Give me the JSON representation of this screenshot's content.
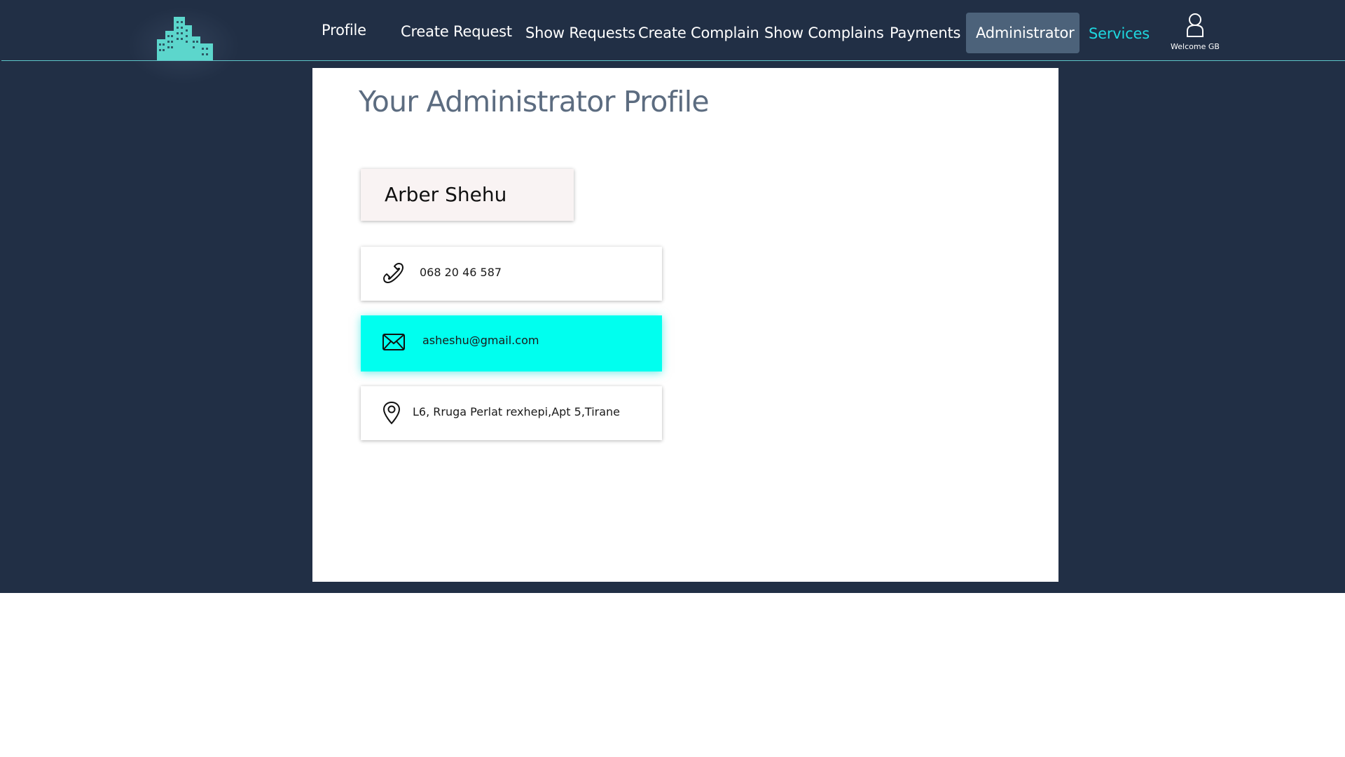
{
  "nav": {
    "items": [
      {
        "label": "Profile"
      },
      {
        "label": "Create Request"
      },
      {
        "label": "Show Requests"
      },
      {
        "label": "Create Complain"
      },
      {
        "label": "Show Complains"
      },
      {
        "label": "Payments"
      },
      {
        "label": "Administrator",
        "active": true
      },
      {
        "label": "Services"
      }
    ],
    "user_label": "Welcome GB",
    "user_icon": "user-icon",
    "logo_icon": "buildings-logo-icon"
  },
  "profile": {
    "title": "Your Administrator Profile",
    "name": "Arber Shehu",
    "phone": "068 20 46 587",
    "email": "asheshu@gmail.com",
    "address": "L6, Rruga Perlat rexhepi,Apt 5,Tirane"
  },
  "colors": {
    "background": "#212f45",
    "accent": "#1ed8e0",
    "email_card": "#00ffef",
    "active_tab": "#4c627a",
    "title": "#5c6c80"
  }
}
